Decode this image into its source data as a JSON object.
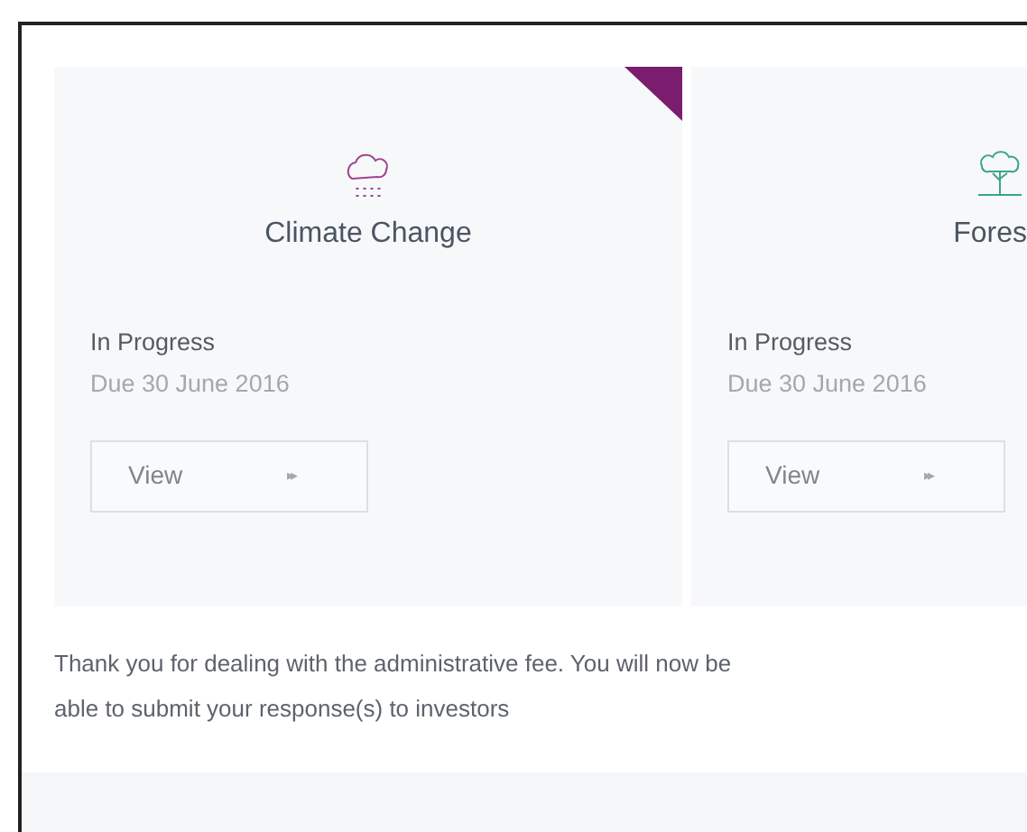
{
  "cards": [
    {
      "kind": "rain-cloud",
      "title": "Climate Change",
      "status": "In Progress",
      "due": "Due 30 June 2016",
      "button": "View",
      "arrow": "▸▸",
      "selected": true
    },
    {
      "kind": "tree",
      "title": "Fores",
      "status": "In Progress",
      "due": "Due 30 June 2016",
      "button": "View",
      "arrow": "▸▸",
      "selected": false
    }
  ],
  "message": "Thank you for dealing with the administrative fee. You will now be able to submit your response(s) to investors"
}
